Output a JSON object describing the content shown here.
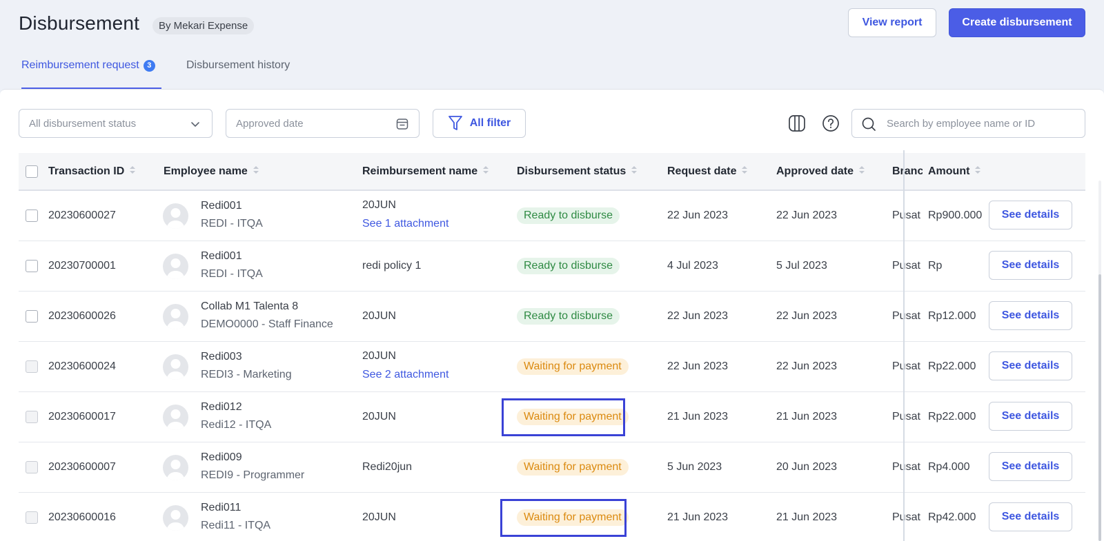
{
  "header": {
    "title": "Disbursement",
    "brand_tag": "By Mekari Expense",
    "view_report_label": "View report",
    "create_label": "Create disbursement"
  },
  "tabs": [
    {
      "label": "Reimbursement request",
      "count": "3",
      "active": true
    },
    {
      "label": "Disbursement history",
      "active": false
    }
  ],
  "filters": {
    "status_placeholder": "All disbursement status",
    "date_placeholder": "Approved date",
    "all_filter_label": "All filter",
    "search_placeholder": "Search by employee name or ID"
  },
  "table": {
    "columns": [
      "Transaction ID",
      "Employee name",
      "Reimbursement name",
      "Disbursement status",
      "Request date",
      "Approved date",
      "Branch",
      "Amount"
    ],
    "see_details_label": "See details",
    "rows": [
      {
        "id": "20230600027",
        "employee": "Redi001",
        "employee_sub": "REDI - ITQA",
        "reimbursement": "20JUN",
        "attachment": "See 1 attachment",
        "status": "Ready to disburse",
        "status_type": "ready",
        "request_date": "22 Jun 2023",
        "approved_date": "22 Jun 2023",
        "branch": "Pusat",
        "amount": "Rp900.000",
        "highlighted": false,
        "checkbox_disabled": false
      },
      {
        "id": "20230700001",
        "employee": "Redi001",
        "employee_sub": "REDI - ITQA",
        "reimbursement": "redi policy 1",
        "attachment": "",
        "status": "Ready to disburse",
        "status_type": "ready",
        "request_date": "4 Jul 2023",
        "approved_date": "5 Jul 2023",
        "branch": "Pusat",
        "amount": "Rp",
        "highlighted": false,
        "checkbox_disabled": false
      },
      {
        "id": "20230600026",
        "employee": "Collab M1 Talenta 8",
        "employee_sub": "DEMO0000 - Staff Finance",
        "reimbursement": "20JUN",
        "attachment": "",
        "status": "Ready to disburse",
        "status_type": "ready",
        "request_date": "22 Jun 2023",
        "approved_date": "22 Jun 2023",
        "branch": "Pusat",
        "amount": "Rp12.000",
        "highlighted": false,
        "checkbox_disabled": false
      },
      {
        "id": "20230600024",
        "employee": "Redi003",
        "employee_sub": "REDI3 - Marketing",
        "reimbursement": "20JUN",
        "attachment": "See 2 attachment",
        "status": "Waiting for payment",
        "status_type": "waiting",
        "request_date": "22 Jun 2023",
        "approved_date": "22 Jun 2023",
        "branch": "Pusat",
        "amount": "Rp22.000",
        "highlighted": false,
        "checkbox_disabled": true
      },
      {
        "id": "20230600017",
        "employee": "Redi012",
        "employee_sub": "Redi12 - ITQA",
        "reimbursement": "20JUN",
        "attachment": "",
        "status": "Waiting for payment",
        "status_type": "waiting",
        "request_date": "21 Jun 2023",
        "approved_date": "21 Jun 2023",
        "branch": "Pusat",
        "amount": "Rp22.000",
        "highlighted": true,
        "checkbox_disabled": true
      },
      {
        "id": "20230600007",
        "employee": "Redi009",
        "employee_sub": "REDI9 - Programmer",
        "reimbursement": "Redi20jun",
        "attachment": "",
        "status": "Waiting for payment",
        "status_type": "waiting",
        "request_date": "5 Jun 2023",
        "approved_date": "20 Jun 2023",
        "branch": "Pusat",
        "amount": "Rp4.000",
        "highlighted": false,
        "checkbox_disabled": true
      },
      {
        "id": "20230600016",
        "employee": "Redi011",
        "employee_sub": "Redi11 - ITQA",
        "reimbursement": "20JUN",
        "attachment": "",
        "status": "Waiting for payment",
        "status_type": "waiting",
        "request_date": "21 Jun 2023",
        "approved_date": "21 Jun 2023",
        "branch": "Pusat",
        "amount": "Rp42.000",
        "highlighted": true,
        "checkbox_disabled": true
      }
    ]
  },
  "colors": {
    "accent": "#4b5de6",
    "link": "#3e57e0",
    "ready_bg": "#e6f4ea",
    "ready_text": "#2e8a43",
    "waiting_bg": "#fdf0d9",
    "waiting_text": "#db8a10",
    "highlight_border": "#3a42d6"
  }
}
